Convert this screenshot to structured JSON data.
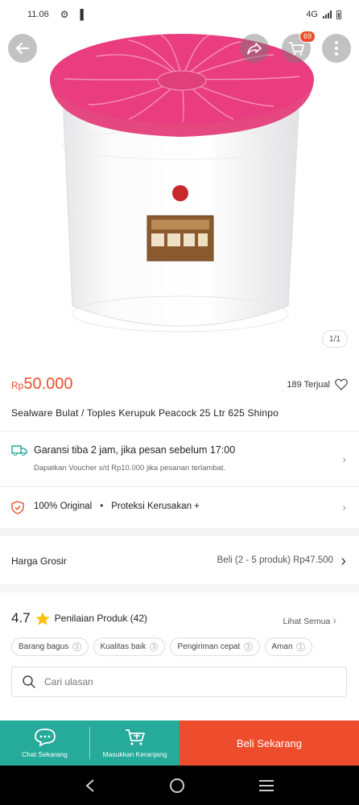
{
  "status": {
    "time": "11.06",
    "network": "4G"
  },
  "header": {
    "cart_count": "69",
    "image_counter": "1/1"
  },
  "product": {
    "price_currency": "Rp",
    "price_amount": "50.000",
    "sold": "189 Terjual",
    "title": "Sealware Bulat / Toples Kerupuk Peacock 25 Ltr  625 Shinpo",
    "lid_color": "#e93d7f"
  },
  "shipping": {
    "title": "Garansi tiba 2 jam, jika pesan sebelum 17:00",
    "subtitle": "Dapatkan Voucher s/d Rp10.000 jika pesanan terlambat."
  },
  "guarantee": {
    "original": "100% Original",
    "dot": "•",
    "protection": "Proteksi Kerusakan +"
  },
  "wholesale": {
    "label": "Harga Grosir",
    "value": "Beli (2 - 5 produk) Rp47.500"
  },
  "reviews": {
    "score": "4.7",
    "label": "Penilaian Produk (42)",
    "see_all": "Lihat Semua",
    "chips": [
      {
        "label": "Barang bagus",
        "count": "3"
      },
      {
        "label": "Kualitas baik",
        "count": "3"
      },
      {
        "label": "Pengiriman cepat",
        "count": "3"
      },
      {
        "label": "Aman",
        "count": "1"
      }
    ],
    "search_placeholder": "Cari ulasan"
  },
  "bottom": {
    "chat": "Chat Sekarang",
    "add_cart": "Masukkan Keranjang",
    "buy": "Beli Sekarang"
  },
  "colors": {
    "accent": "#ee4d2d",
    "teal": "#26aa99"
  }
}
